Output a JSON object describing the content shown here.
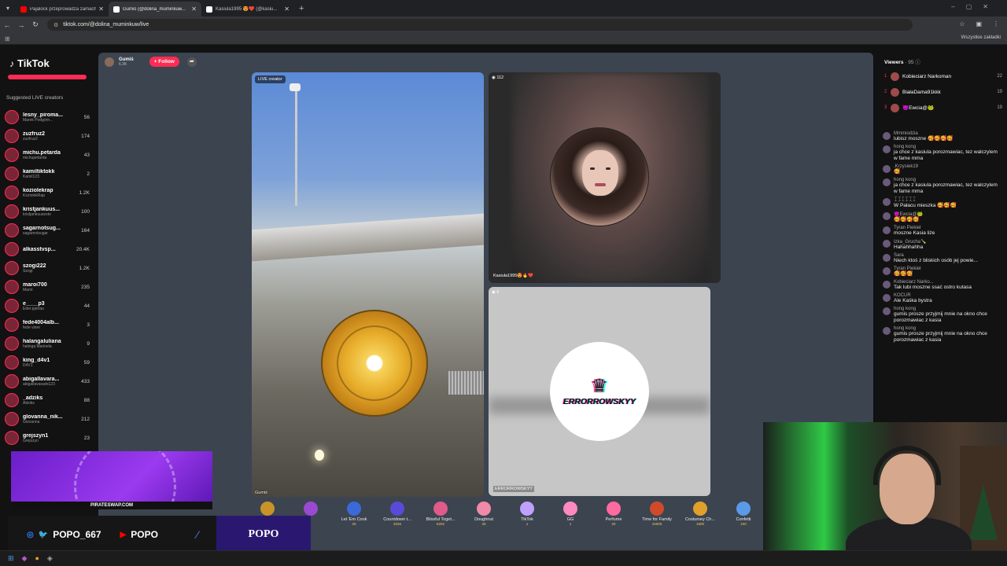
{
  "browser": {
    "tabs": [
      {
        "title": "Pajalock przeprowadza zamach",
        "color": "#ff0000"
      },
      {
        "title": "Gumiś (@dolina_muminkuw...",
        "color": "#ffffff"
      },
      {
        "title": "Kasiula1995 😍❤️ (@kasiu...",
        "color": "#ffffff"
      }
    ],
    "url": "tiktok.com/@dolina_muminkuw/live",
    "bookmarks_all": "Wszystkie zakładki"
  },
  "sidebar": {
    "logo": "TikTok",
    "suggested_title": "Suggested LIVE creators",
    "creators": [
      {
        "name": "lesny_piroma...",
        "sub": "Marek Podgórn...",
        "count": "56"
      },
      {
        "name": "zuzfruz2",
        "sub": "zuzfruz2",
        "count": "174"
      },
      {
        "name": "michu.petarda",
        "sub": "michupetarda",
        "count": "43"
      },
      {
        "name": "kamiltiktokk",
        "sub": "Kamil123",
        "count": "2"
      },
      {
        "name": "koziolekrap",
        "sub": "KoziolekRap",
        "count": "1.2K"
      },
      {
        "name": "kristjankuus...",
        "sub": "kristjankuuseste",
        "count": "100"
      },
      {
        "name": "sagarnotsug...",
        "sub": "sagarnotsugar",
        "count": "164"
      },
      {
        "name": "alkasstvsp...",
        "sub": "",
        "count": "20.4K"
      },
      {
        "name": "szogi222",
        "sub": "Szogi",
        "count": "1.2K"
      },
      {
        "name": "maroi700",
        "sub": "Maroi",
        "count": "235"
      },
      {
        "name": "e____p3",
        "sub": "Eder.pjetrau",
        "count": "44"
      },
      {
        "name": "fede4004alb...",
        "sub": "fede viore",
        "count": "3"
      },
      {
        "name": "halangaluliana",
        "sub": "halinga Marinela",
        "count": "9"
      },
      {
        "name": "king_d4v1",
        "sub": "D4V1",
        "count": "59"
      },
      {
        "name": "abigallavara...",
        "sub": "abigallavarado123",
        "count": "433"
      },
      {
        "name": "_adziks",
        "sub": "Adziks",
        "count": "88"
      },
      {
        "name": "glovanna_nik...",
        "sub": "Giovanna",
        "count": "212"
      },
      {
        "name": "grejszyn1",
        "sub": "Grejszyn",
        "count": "23"
      }
    ]
  },
  "stage": {
    "host_name": "Gumiś",
    "host_sub": "6.3K",
    "follow_label": "+ Follow",
    "main_badge": "LIVE creator",
    "main_label": "Gumiś",
    "guest1_viewers": "112",
    "guest1_label": "Kasiula1995😍🔥❤️",
    "guest2_viewers": "6",
    "guest2_label": "ERRORROWSKYY",
    "guest2_logo": "ERRORROWSKYY"
  },
  "gifts": [
    {
      "name": "",
      "price": "",
      "color": "#c9932a"
    },
    {
      "name": "",
      "price": "",
      "color": "#9a4ad0"
    },
    {
      "name": "Let 'Em Cook",
      "price": "20",
      "color": "#3a6ad8"
    },
    {
      "name": "Countdown t...",
      "price": "2026",
      "color": "#5a4ad8"
    },
    {
      "name": "Blissful Toget...",
      "price": "6202",
      "color": "#e05a8a"
    },
    {
      "name": "Doughnut",
      "price": "30",
      "color": "#f08aa8"
    },
    {
      "name": "TikTok",
      "price": "1",
      "color": "#c0a0ff"
    },
    {
      "name": "GG",
      "price": "1",
      "color": "#ff8ac0"
    },
    {
      "name": "Perfume",
      "price": "20",
      "color": "#ff6aa0"
    },
    {
      "name": "Time for Family",
      "price": "15000",
      "color": "#d04a2a"
    },
    {
      "name": "Costumey Ch...",
      "price": "1500",
      "color": "#e0a02a"
    },
    {
      "name": "Confetti",
      "price": "100",
      "color": "#5a9ae8"
    }
  ],
  "chat": {
    "viewers_title": "Viewers",
    "viewers_count": "· 95",
    "top": [
      {
        "rank": "1",
        "name": "Kobieciarz Narkoman",
        "score": "22"
      },
      {
        "rank": "2",
        "name": "BiałaDama91kkk",
        "score": "19"
      },
      {
        "rank": "3",
        "name": "😈Ewcia@🐸",
        "score": "19"
      }
    ],
    "messages": [
      {
        "user": "Mmmiodzia",
        "text": "lubisz moszne 🥰🥰🥰🥰"
      },
      {
        "user": "hong kong",
        "text": "ja chce z kasiula porozmawiac, tez walczylem w fame mma"
      },
      {
        "user": ".Krzysiek19",
        "text": "🥰"
      },
      {
        "user": "hong kong",
        "text": "ja chce z kasiula porozmawiac, tez walczylem w fame mma"
      },
      {
        "user": "ꀤꀤꀤꀤꀤꀤ",
        "text": "W Pałacu mieszka 🥰🥰🥰"
      },
      {
        "user": "😈Ewcia@🐸",
        "text": "🥰🥰🥰🥰"
      },
      {
        "user": "Tyran Piekieł",
        "text": "moszne Kasia liże"
      },
      {
        "user": "Izka_Grucha🍾",
        "text": "Hahahhahha"
      },
      {
        "user": "Sara",
        "text": "Niech ktoś z bliskich osób jej powie..."
      },
      {
        "user": "Tyran Piekieł",
        "text": "🥰🥰🥰"
      },
      {
        "user": "Kobieciarz Narko...",
        "text": "Tak lubi moszne ssać ostro kutasa"
      },
      {
        "user": "KOCUR",
        "text": "Ale Kaśka bystra"
      },
      {
        "user": "hong kong",
        "text": "gumis prosze przyjmij mnie na okno chce porozmawiac z kasia"
      },
      {
        "user": "hong kong",
        "text": "gumis prosze przyjmij mnie na okno chce porozmawiac z kasia"
      }
    ]
  },
  "overlay": {
    "promo": "PIRATESWAP.COM",
    "social1": "POPO_667",
    "social2": "POPO",
    "kick": "POPO"
  }
}
